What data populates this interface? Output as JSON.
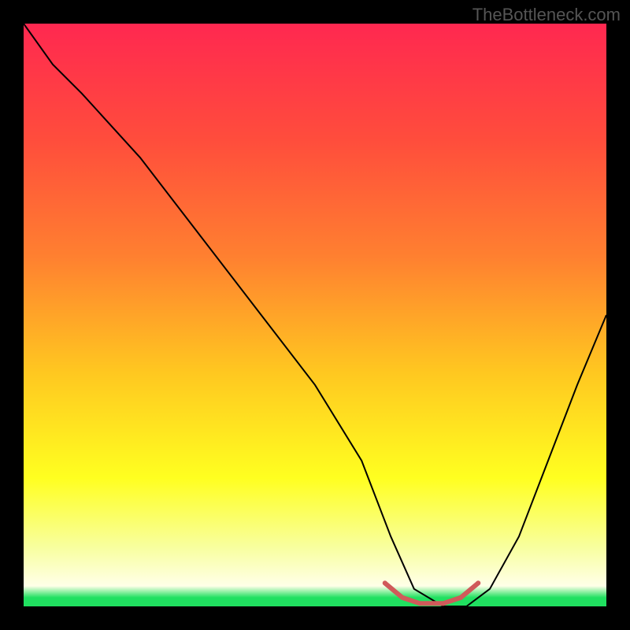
{
  "watermark": "TheBottleneck.com",
  "chart_data": {
    "type": "line",
    "title": "",
    "xlabel": "",
    "ylabel": "",
    "x_range": [
      0,
      100
    ],
    "y_range": [
      0,
      100
    ],
    "gradient_stops": [
      {
        "offset": 0.0,
        "color": "#ff2850"
      },
      {
        "offset": 0.2,
        "color": "#ff4d3c"
      },
      {
        "offset": 0.4,
        "color": "#ff8030"
      },
      {
        "offset": 0.6,
        "color": "#ffc820"
      },
      {
        "offset": 0.78,
        "color": "#ffff20"
      },
      {
        "offset": 0.9,
        "color": "#f8ffa0"
      },
      {
        "offset": 0.965,
        "color": "#ffffe8"
      },
      {
        "offset": 0.985,
        "color": "#20e060"
      }
    ],
    "series": [
      {
        "name": "bottleneck-curve",
        "color": "#000000",
        "width": 2,
        "x": [
          0,
          5,
          10,
          20,
          30,
          40,
          50,
          58,
          63,
          67,
          72,
          76,
          80,
          85,
          90,
          95,
          100
        ],
        "y": [
          100,
          93,
          88,
          77,
          64,
          51,
          38,
          25,
          12,
          3,
          0,
          0,
          3,
          12,
          25,
          38,
          50
        ]
      },
      {
        "name": "target-zone",
        "color": "#d05a5a",
        "width": 6,
        "x": [
          62,
          65,
          68,
          72,
          75,
          78
        ],
        "y": [
          4,
          1.5,
          0.5,
          0.5,
          1.5,
          4
        ]
      }
    ],
    "target_dots": {
      "color": "#d05a5a",
      "r": 3,
      "points": [
        {
          "x": 62,
          "y": 4
        },
        {
          "x": 65,
          "y": 1.5
        },
        {
          "x": 68,
          "y": 0.5
        },
        {
          "x": 72,
          "y": 0.5
        },
        {
          "x": 75,
          "y": 1.5
        },
        {
          "x": 78,
          "y": 4
        }
      ]
    }
  }
}
